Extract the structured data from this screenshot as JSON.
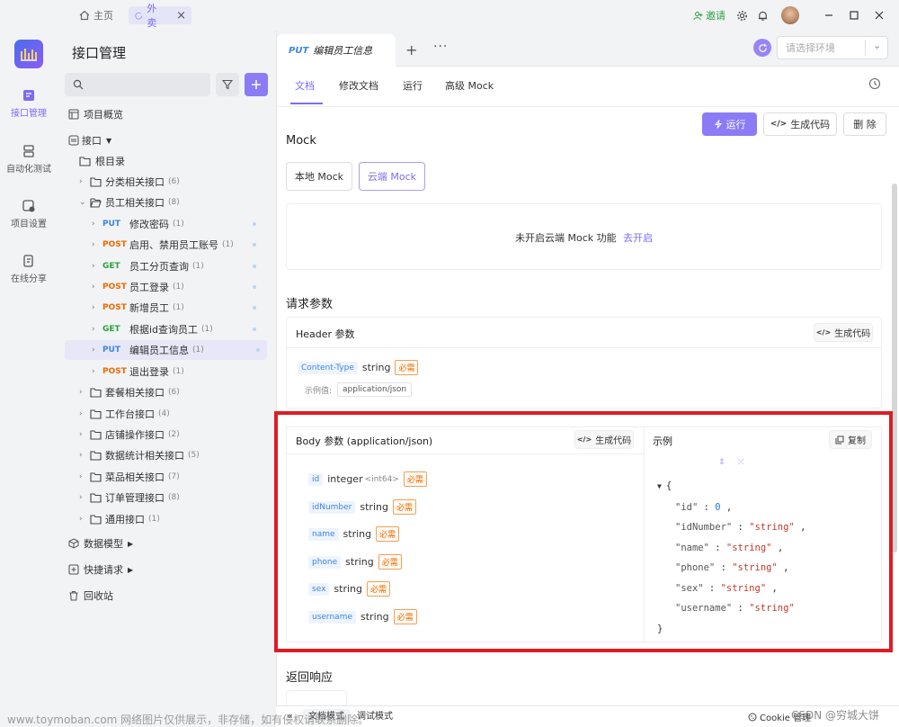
{
  "titlebar": {
    "tabs": [
      {
        "label": "主页",
        "icon": "home-icon"
      },
      {
        "label": "外卖",
        "icon": "refresh-icon",
        "close": "×"
      }
    ],
    "invite_label": "邀请"
  },
  "rail": {
    "items": [
      {
        "label": "接口管理",
        "icon": "api-icon"
      },
      {
        "label": "自动化测试",
        "icon": "automation-icon"
      },
      {
        "label": "项目设置",
        "icon": "settings-icon"
      },
      {
        "label": "在线分享",
        "icon": "share-icon"
      }
    ]
  },
  "sidebar": {
    "title": "接口管理",
    "search_placeholder": "",
    "overview": "项目概览",
    "interfaces": "接口",
    "root": "根目录",
    "folders_top": [
      {
        "label": "分类相关接口",
        "count": "(6)",
        "expanded": false
      },
      {
        "label": "员工相关接口",
        "count": "(8)",
        "expanded": true
      }
    ],
    "endpoints": [
      {
        "method": "PUT",
        "label": "修改密码",
        "count": "(1)"
      },
      {
        "method": "POST",
        "label": "启用、禁用员工账号",
        "count": "(1)"
      },
      {
        "method": "GET",
        "label": "员工分页查询",
        "count": "(1)"
      },
      {
        "method": "POST",
        "label": "员工登录",
        "count": "(1)"
      },
      {
        "method": "POST",
        "label": "新增员工",
        "count": "(1)"
      },
      {
        "method": "GET",
        "label": "根据id查询员工",
        "count": "(1)"
      },
      {
        "method": "PUT",
        "label": "编辑员工信息",
        "count": "(1)",
        "selected": true
      },
      {
        "method": "POST",
        "label": "退出登录",
        "count": "(1)"
      }
    ],
    "folders_bottom": [
      {
        "label": "套餐相关接口",
        "count": "(6)"
      },
      {
        "label": "工作台接口",
        "count": "(4)"
      },
      {
        "label": "店铺操作接口",
        "count": "(2)"
      },
      {
        "label": "数据统计相关接口",
        "count": "(5)"
      },
      {
        "label": "菜品相关接口",
        "count": "(7)"
      },
      {
        "label": "订单管理接口",
        "count": "(8)"
      },
      {
        "label": "通用接口",
        "count": "(1)"
      }
    ],
    "data_model": "数据模型",
    "quick_request": "快捷请求",
    "trash": "回收站"
  },
  "colors": {
    "accent": "#7b6cf6",
    "put": "#3d86e0",
    "post": "#f06a00",
    "get": "#2ea043",
    "required": "#f06a00",
    "highlight": "#e01b24"
  },
  "main": {
    "doc_tab": {
      "method": "PUT",
      "title": "编辑员工信息"
    },
    "env_placeholder": "请选择环境",
    "subtabs": [
      "文档",
      "修改文档",
      "运行",
      "高级 Mock"
    ],
    "actions": {
      "run": "运行",
      "gen_code": "生成代码",
      "delete": "删 除"
    },
    "mock": {
      "title": "Mock",
      "local": "本地 Mock",
      "cloud": "云端 Mock",
      "notice": "未开启云端 Mock 功能",
      "enable": "去开启"
    },
    "request_params": "请求参数",
    "header": {
      "title": "Header 参数",
      "gen_code": "生成代码",
      "param": {
        "name": "Content-Type",
        "type": "string",
        "required": "必需"
      },
      "example_label": "示例值:",
      "example_value": "application/json"
    },
    "body": {
      "title": "Body 参数 (application/json)",
      "gen_code": "生成代码",
      "example_title": "示例",
      "copy": "复制",
      "params": [
        {
          "name": "id",
          "type": "integer",
          "format": "<int64>",
          "required": "必需"
        },
        {
          "name": "idNumber",
          "type": "string",
          "required": "必需"
        },
        {
          "name": "name",
          "type": "string",
          "required": "必需"
        },
        {
          "name": "phone",
          "type": "string",
          "required": "必需"
        },
        {
          "name": "sex",
          "type": "string",
          "required": "必需"
        },
        {
          "name": "username",
          "type": "string",
          "required": "必需"
        }
      ],
      "example_json": {
        "open": "{",
        "lines": [
          {
            "key": "\"id\"",
            "value": "0",
            "kind": "num",
            "comma": ","
          },
          {
            "key": "\"idNumber\"",
            "value": "\"string\"",
            "kind": "str",
            "comma": ","
          },
          {
            "key": "\"name\"",
            "value": "\"string\"",
            "kind": "str",
            "comma": ","
          },
          {
            "key": "\"phone\"",
            "value": "\"string\"",
            "kind": "str",
            "comma": ","
          },
          {
            "key": "\"sex\"",
            "value": "\"string\"",
            "kind": "str",
            "comma": ","
          },
          {
            "key": "\"username\"",
            "value": "\"string\"",
            "kind": "str",
            "comma": ""
          }
        ],
        "close": "}"
      }
    },
    "response_title": "返回响应"
  },
  "statusbar": {
    "doc_mode": "文档模式",
    "debug_mode": "调试模式",
    "cookie": "Cookie 管理"
  },
  "watermark": {
    "left": "www.toymoban.com 网络图片仅供展示，非存储，如有侵权请联系删除。",
    "right": "CSDN @穷城大饼"
  }
}
